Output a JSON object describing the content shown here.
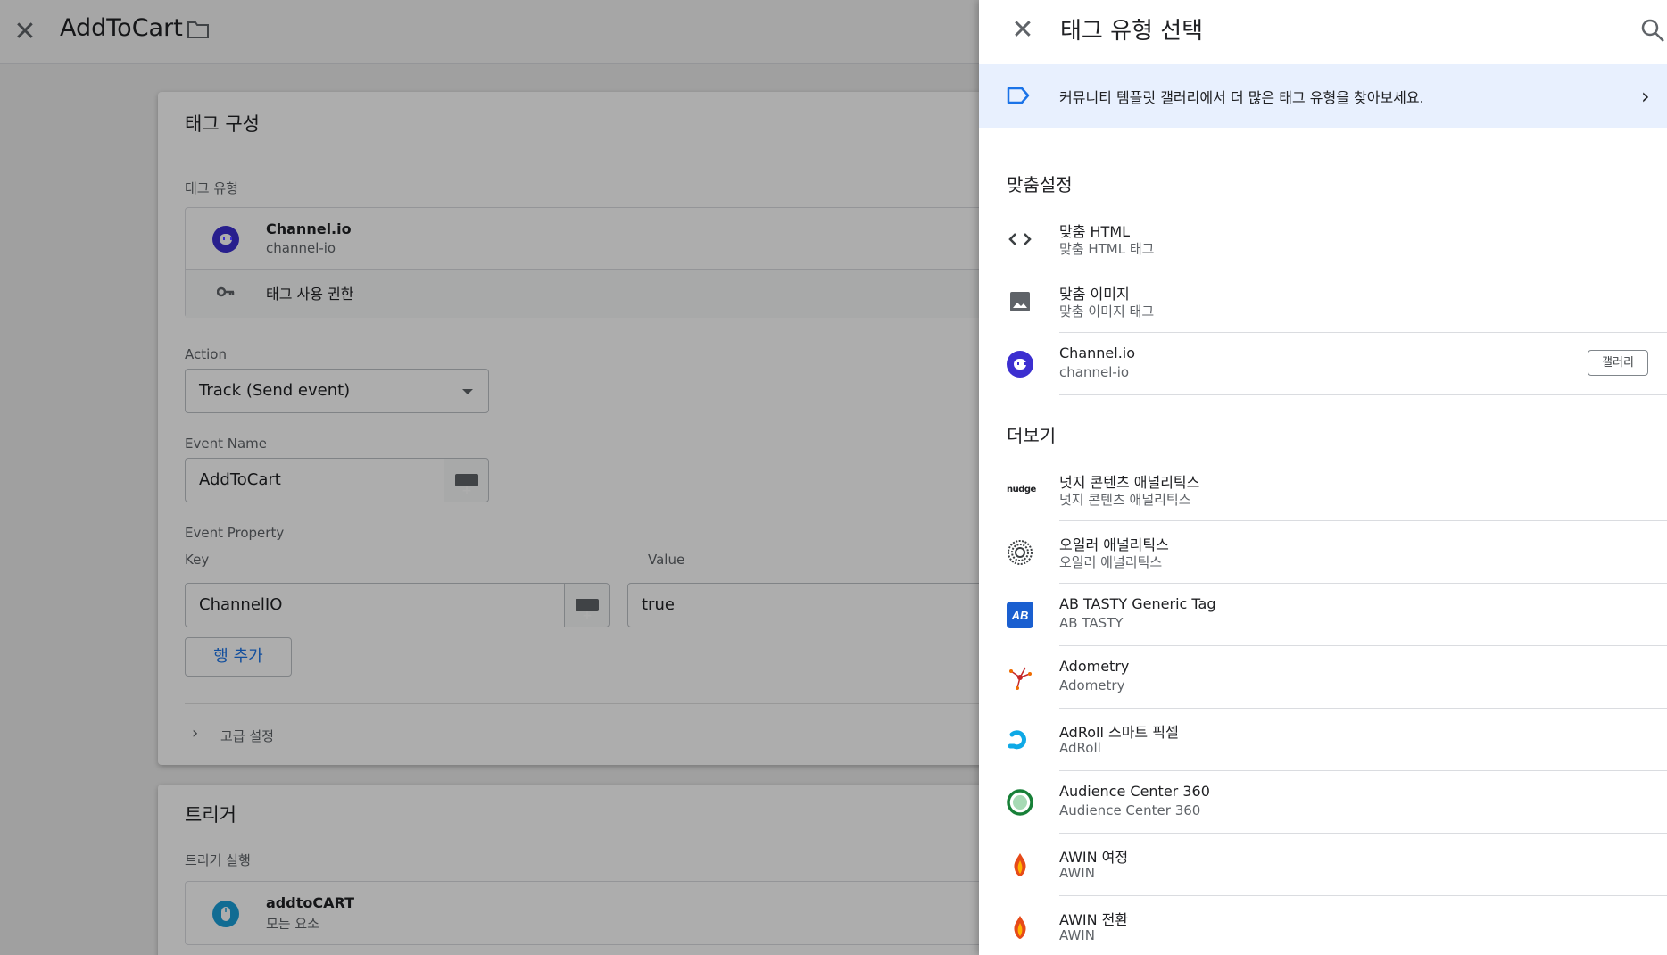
{
  "editor": {
    "title": "AddToCart",
    "tag_config": {
      "card_title": "태그 구성",
      "tag_type_label": "태그 유형",
      "tag_type_name": "Channel.io",
      "tag_type_id": "channel-io",
      "permission_label": "태그 사용 권한",
      "action_label": "Action",
      "action_value": "Track (Send event)",
      "event_name_label": "Event Name",
      "event_name_value": "AddToCart",
      "event_property_label": "Event Property",
      "key_label": "Key",
      "value_label": "Value",
      "key_value": "ChannelIO",
      "value_value": "true",
      "add_row_label": "행 추가",
      "advanced_label": "고급 설정"
    },
    "trigger": {
      "card_title": "트리거",
      "fire_label": "트리거 실행",
      "trigger_name": "addtoCART",
      "trigger_type": "모든 요소"
    }
  },
  "panel": {
    "title": "태그 유형 선택",
    "banner_text": "커뮤니티 템플릿 갤러리에서 더 많은 태그 유형을 찾아보세요.",
    "custom_section": "맞춤설정",
    "custom_items": [
      {
        "name": "맞춤 HTML",
        "sub": "맞춤 HTML 태그",
        "icon": "code-icon"
      },
      {
        "name": "맞춤 이미지",
        "sub": "맞춤 이미지 태그",
        "icon": "image-icon"
      },
      {
        "name": "Channel.io",
        "sub": "channel-io",
        "icon": "channel-io-icon",
        "badge": "갤러리"
      }
    ],
    "more_section": "더보기",
    "more_items": [
      {
        "name": "넛지 콘텐츠 애널리틱스",
        "sub": "넛지 콘텐츠 애널리틱스",
        "icon": "nudge-logo-icon",
        "logo_text": "nudge"
      },
      {
        "name": "오일러 애널리틱스",
        "sub": "오일러 애널리틱스",
        "icon": "euler-logo-icon"
      },
      {
        "name": "AB TASTY Generic Tag",
        "sub": "AB TASTY",
        "icon": "abtasty-logo-icon"
      },
      {
        "name": "Adometry",
        "sub": "Adometry",
        "icon": "adometry-logo-icon"
      },
      {
        "name": "AdRoll 스마트 픽셀",
        "sub": "AdRoll",
        "icon": "adroll-logo-icon"
      },
      {
        "name": "Audience Center 360",
        "sub": "Audience Center 360",
        "icon": "audience-center-logo-icon"
      },
      {
        "name": "AWIN 여정",
        "sub": "AWIN",
        "icon": "awin-logo-icon"
      },
      {
        "name": "AWIN 전환",
        "sub": "AWIN",
        "icon": "awin-logo-icon"
      }
    ]
  }
}
